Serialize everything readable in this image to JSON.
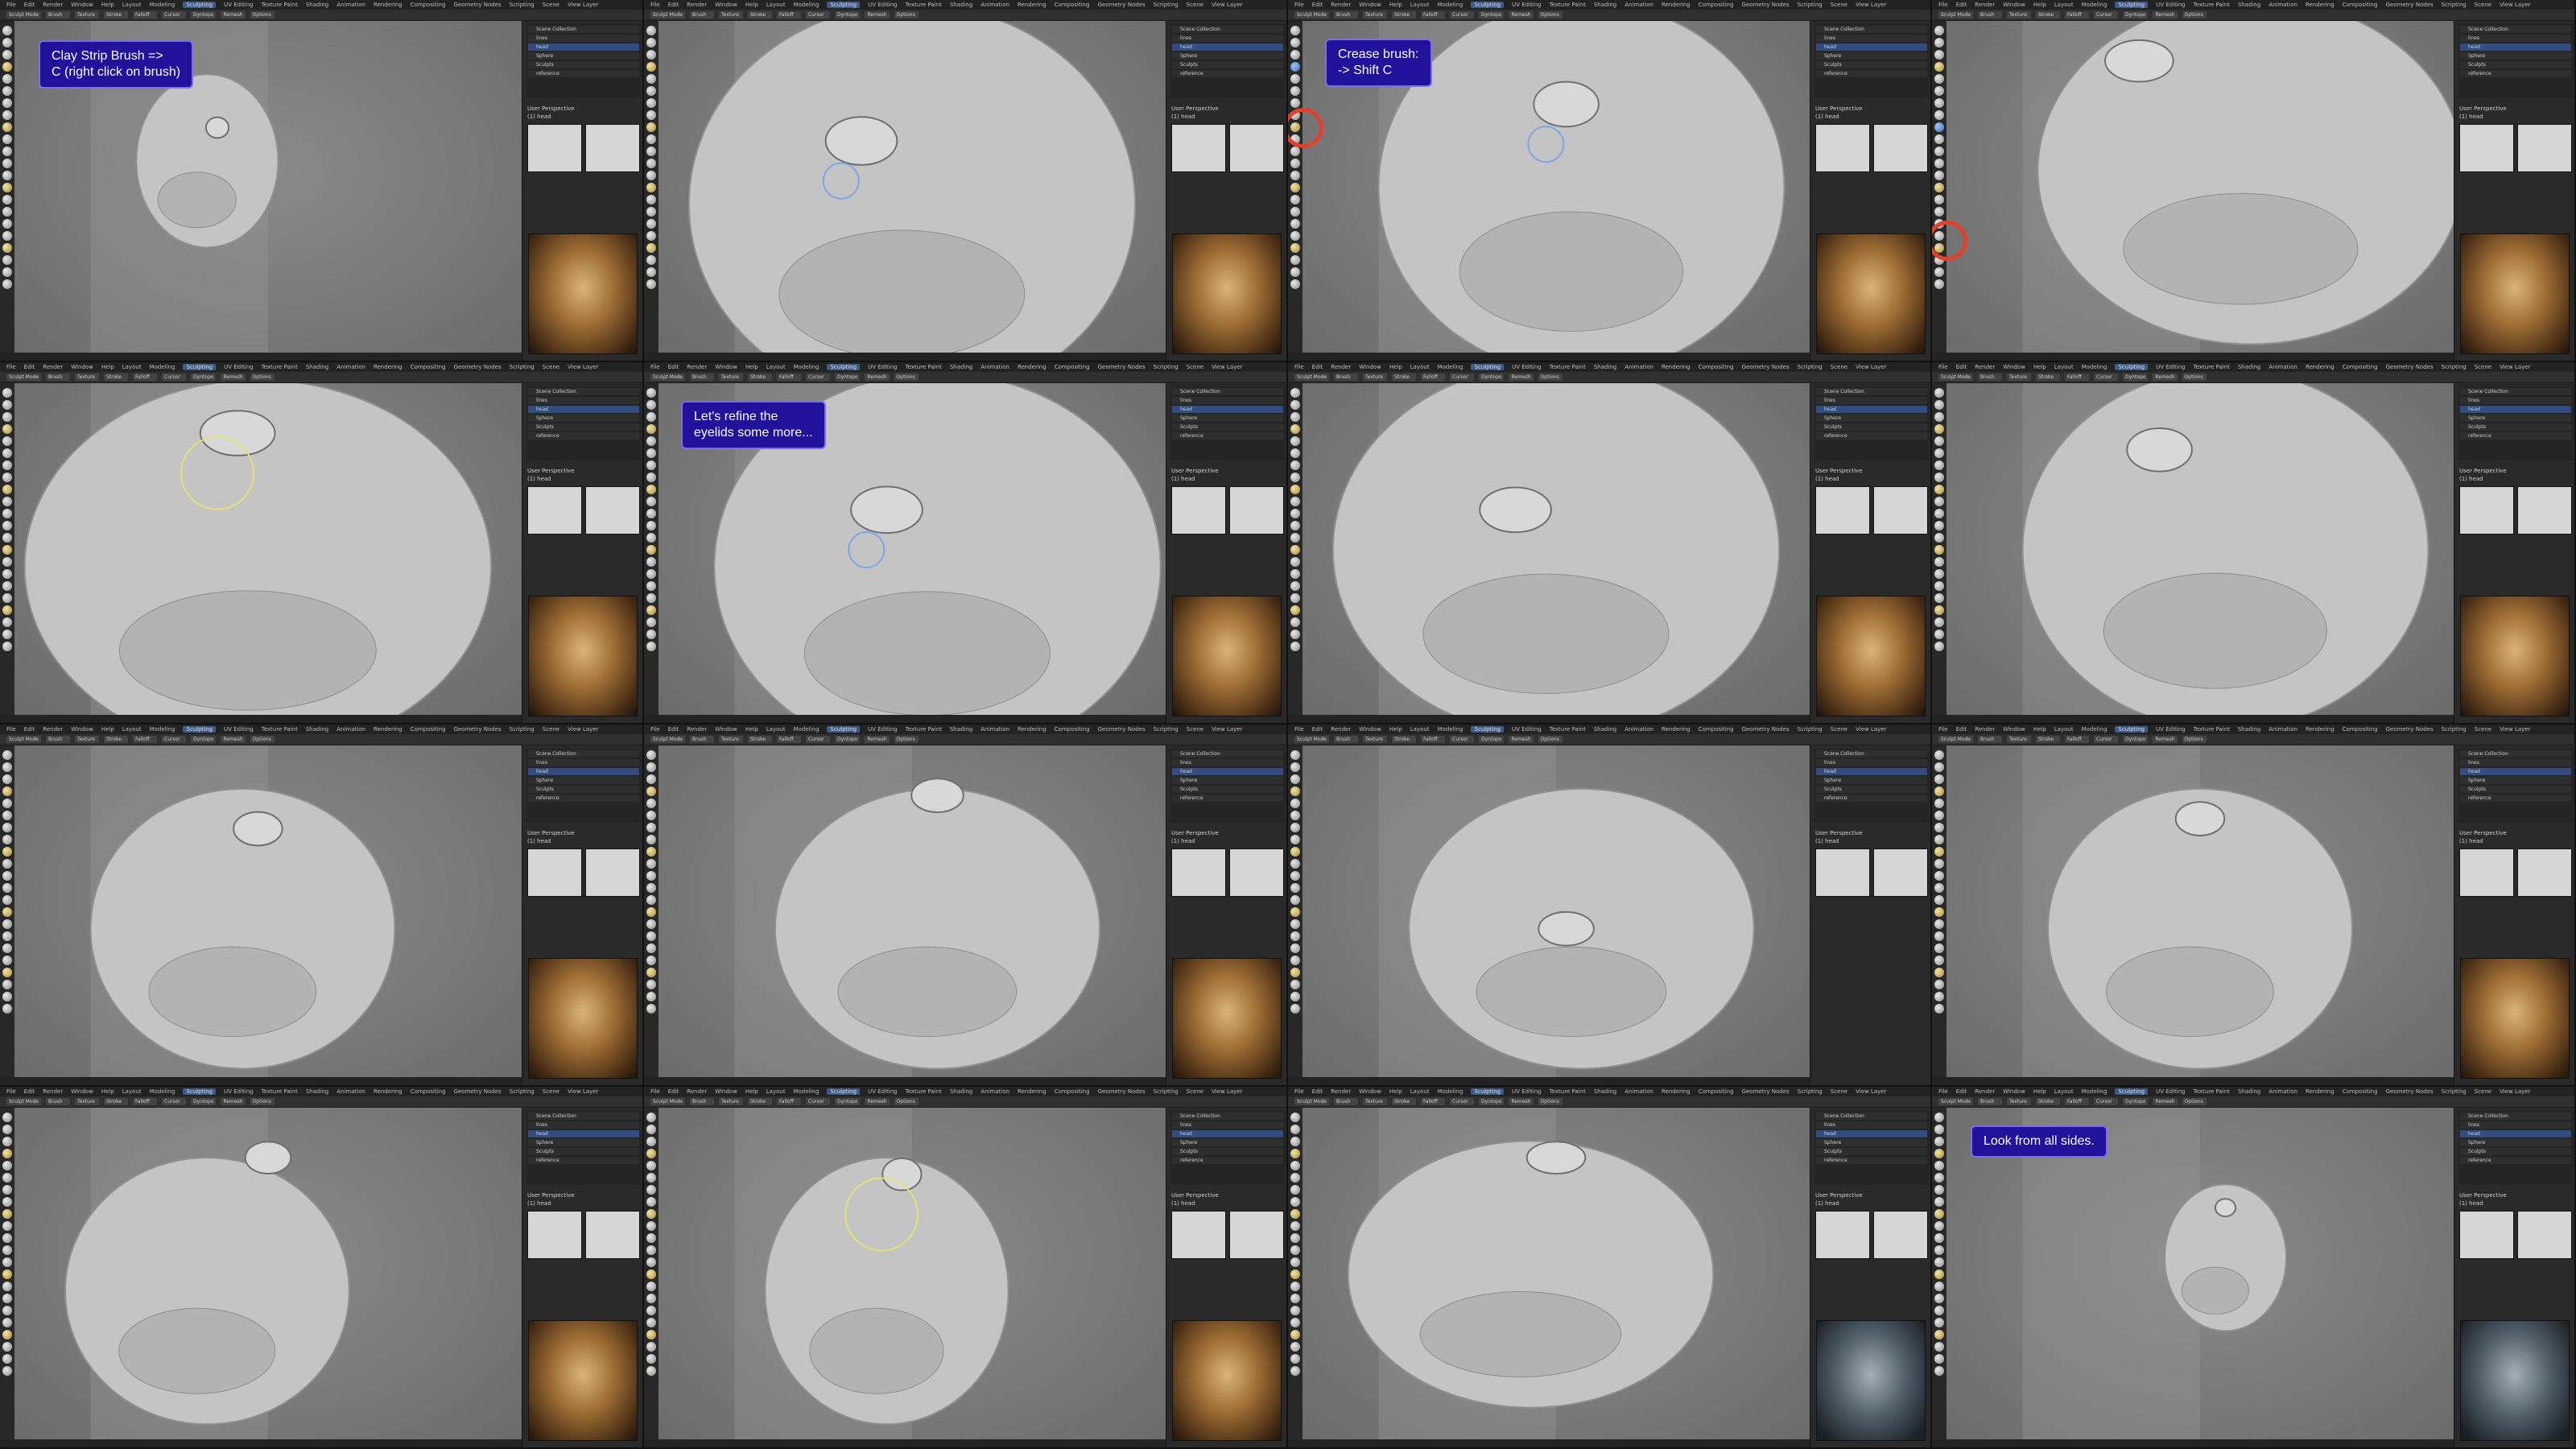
{
  "app": {
    "name": "Blender",
    "workspace_active": "Sculpting",
    "mode": "Sculpt Mode",
    "menu": [
      "File",
      "Edit",
      "Render",
      "Window",
      "Help"
    ],
    "workspaces": [
      "Layout",
      "Modeling",
      "Sculpting",
      "UV Editing",
      "Texture Paint",
      "Shading",
      "Animation",
      "Rendering",
      "Compositing",
      "Geometry Nodes",
      "Scripting"
    ],
    "tool_settings": [
      "Brush",
      "Texture",
      "Stroke",
      "Falloff",
      "Cursor",
      "Dyntopo",
      "Remesh",
      "Options"
    ],
    "scene": "Scene",
    "view_layer": "View Layer",
    "viewport_label_1": "User Perspective",
    "viewport_label_2": "(1) head"
  },
  "outliner": {
    "items": [
      "Scene Collection",
      "lines",
      "head",
      "Sphere",
      "Sculpts",
      "reference"
    ]
  },
  "panels": [
    {
      "id": "p1",
      "callout": "Clay Strip Brush =>\nC (right click on brush)",
      "photo": "warm"
    },
    {
      "id": "p2",
      "callout": "",
      "photo": "warm"
    },
    {
      "id": "p3",
      "callout": "Crease brush:\n-> Shift C",
      "photo": "warm"
    },
    {
      "id": "p4",
      "callout": "",
      "photo": "warm"
    },
    {
      "id": "p5",
      "callout": "",
      "photo": "warm"
    },
    {
      "id": "p6",
      "callout": "Let's refine the\neyelids some more...",
      "photo": "warm"
    },
    {
      "id": "p7",
      "callout": "",
      "photo": "warm"
    },
    {
      "id": "p8",
      "callout": "",
      "photo": "warm"
    },
    {
      "id": "p9",
      "callout": "",
      "photo": "warm"
    },
    {
      "id": "p10",
      "callout": "",
      "photo": "warm"
    },
    {
      "id": "p11",
      "callout": "",
      "photo": "none"
    },
    {
      "id": "p12",
      "callout": "",
      "photo": "warm"
    },
    {
      "id": "p13",
      "callout": "",
      "photo": "warm"
    },
    {
      "id": "p14",
      "callout": "",
      "photo": "warm"
    },
    {
      "id": "p15",
      "callout": "",
      "photo": "dark"
    },
    {
      "id": "p16",
      "callout": "Look from all sides.",
      "photo": "dark"
    }
  ],
  "colors": {
    "callout_bg": "#20129a",
    "callout_border": "#7a6ee8",
    "highlight_ring": "#e0412d",
    "active_blue": "#4772b3"
  }
}
